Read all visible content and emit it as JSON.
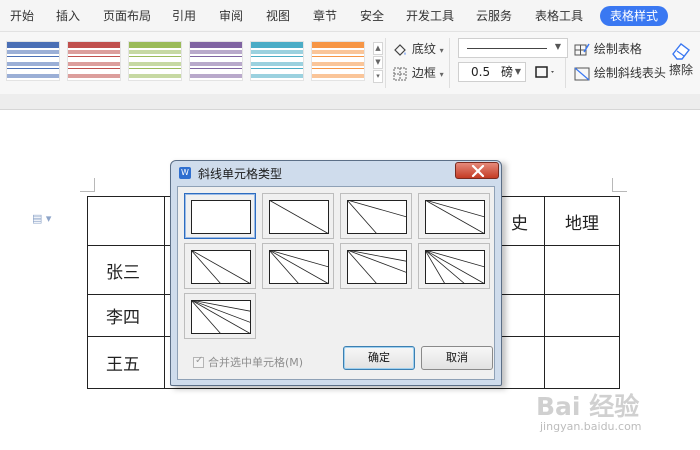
{
  "menu": {
    "items": [
      "开始",
      "插入",
      "页面布局",
      "引用",
      "审阅",
      "视图",
      "章节",
      "安全",
      "开发工具",
      "云服务",
      "表格工具"
    ],
    "active": "表格样式"
  },
  "ribbon": {
    "style_colors": [
      "#4a6fb5",
      "#c0504d",
      "#9bbb59",
      "#8064a2",
      "#4bacc6",
      "#f79646"
    ],
    "shading_label": "底纹",
    "border_label": "边框",
    "line_width_value": "0.5",
    "line_width_unit": "磅",
    "draw_table_label": "绘制表格",
    "draw_diagonal_label": "绘制斜线表头",
    "eraser_label": "擦除"
  },
  "document": {
    "table": {
      "header_visible": [
        "",
        "史",
        "地理"
      ],
      "rows": [
        {
          "name": "张三"
        },
        {
          "name": "李四"
        },
        {
          "name": "王五"
        }
      ]
    }
  },
  "dialog": {
    "title": "斜线单元格类型",
    "types_count": 9,
    "selected_index": 0,
    "merge_label": "合并选中单元格(M)",
    "merge_checked": true,
    "ok_label": "确定",
    "cancel_label": "取消"
  },
  "watermark": {
    "logo": "Bai 经验",
    "url": "jingyan.baidu.com"
  }
}
